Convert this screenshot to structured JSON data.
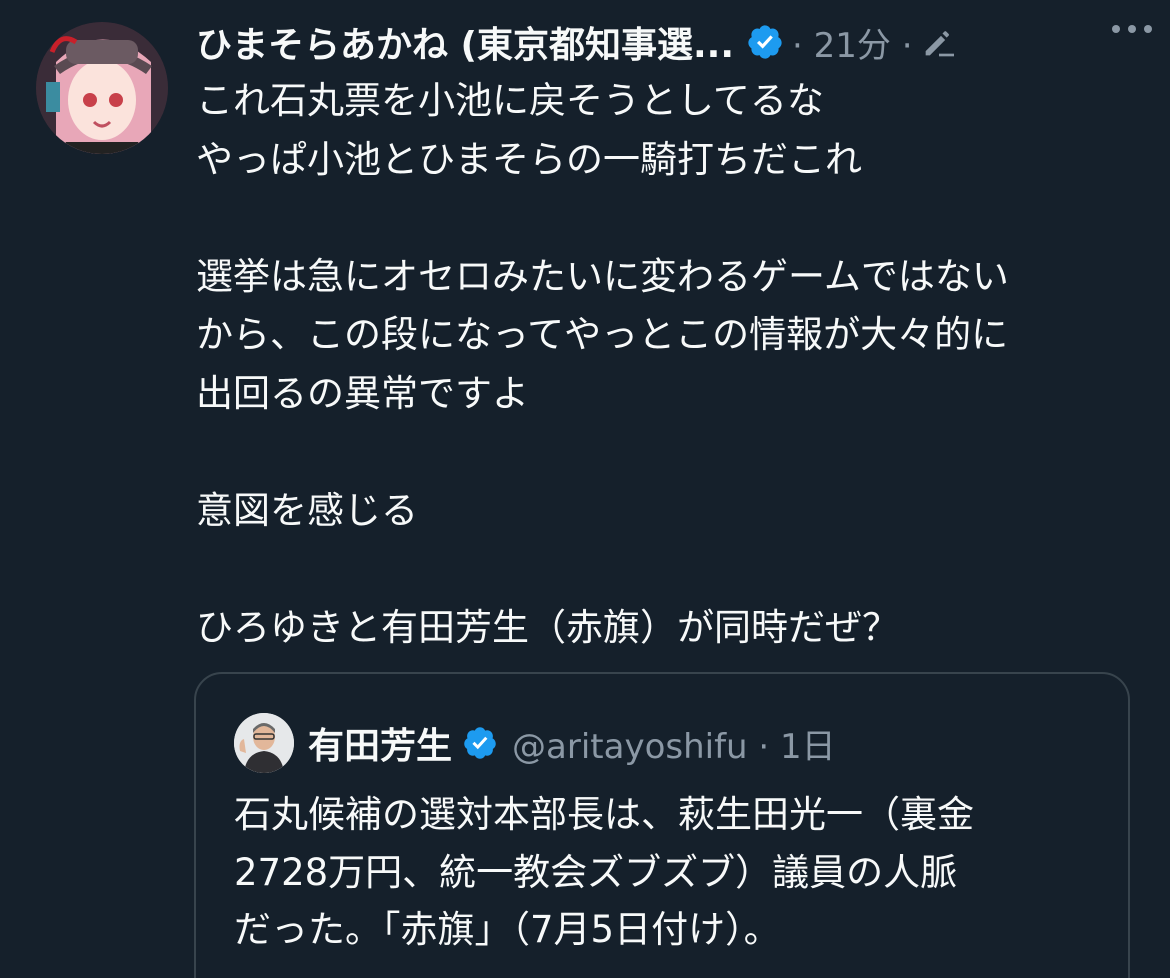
{
  "tweet": {
    "author_name": "ひまそらあかね (東京都知事選...",
    "meta": "· 21分 ·",
    "body_lines": [
      "これ石丸票を小池に戻そうとしてるな",
      "やっぱ小池とひまそらの一騎打ちだこれ",
      "選挙は急にオセロみたいに変わるゲームではない",
      "から、この段になってやっとこの情報が大々的に",
      "出回るの異常ですよ",
      "意図を感じる",
      "ひろゆきと有田芳生（赤旗）が同時だぜ？"
    ]
  },
  "quoted_tweet": {
    "author_name": "有田芳生",
    "handle_meta": "@aritayoshifu · 1日",
    "body_lines": [
      "石丸候補の選対本部長は、萩生田光一（裏金",
      "2728万円、統一教会ズブズブ）議員の人脈",
      "だった。「赤旗」（7月5日付け）。"
    ]
  },
  "icons": {
    "verified": "verified-badge-icon",
    "edit": "edited-pencil-icon",
    "more": "more-options-icon"
  },
  "colors": {
    "background": "#15202b",
    "text_primary": "#f7f9f9",
    "text_secondary": "#8b98a5",
    "verified": "#1d9bf0",
    "border": "#38444d"
  }
}
